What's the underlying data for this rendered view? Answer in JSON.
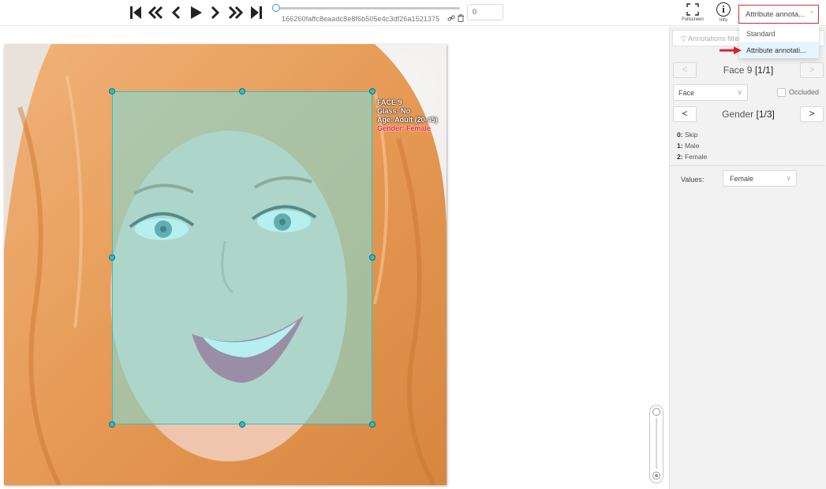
{
  "player": {
    "first_icon": "first-frame-icon",
    "back_icon": "fast-backward-icon",
    "prev_icon": "previous-frame-icon",
    "play_icon": "play-icon",
    "next_icon": "next-frame-icon",
    "forward_icon": "fast-forward-icon",
    "last_icon": "last-frame-icon",
    "job_name": "166260faffc8eaadc8e8f6b505e4c3df26a1521375",
    "frame_number": "0"
  },
  "header": {
    "fullscreen_label": "Fullscreen",
    "info_label": "Info",
    "mode_value": "Attribute annota..."
  },
  "mode_dropdown": {
    "options": [
      "Standard",
      "Attribute annotati..."
    ],
    "selected_index": 1
  },
  "annotation": {
    "labels": [
      "FACE 9",
      "Glass: No",
      "Age: Adult (20-45)",
      "Gender: Female"
    ],
    "highlighted_index": 3,
    "box_color": "#2fc0c6"
  },
  "sidebar": {
    "filter_placeholder": "Annotations filter",
    "object_title": "Face 9",
    "object_counter": "[1/1]",
    "label_value": "Face",
    "occluded_label": "Occluded",
    "attribute_title": "Gender",
    "attribute_counter": "[1/3]",
    "attribute_values": [
      {
        "key": "0:",
        "value": "Skip"
      },
      {
        "key": "1:",
        "value": "Male"
      },
      {
        "key": "2:",
        "value": "Female"
      }
    ],
    "values_label": "Values:",
    "values_selected": "Female",
    "prev_symbol": "<",
    "next_symbol": ">"
  },
  "colors": {
    "accent": "#3a8ee6",
    "highlight_border": "#d32f3a",
    "arrow": "#e01f2b"
  }
}
